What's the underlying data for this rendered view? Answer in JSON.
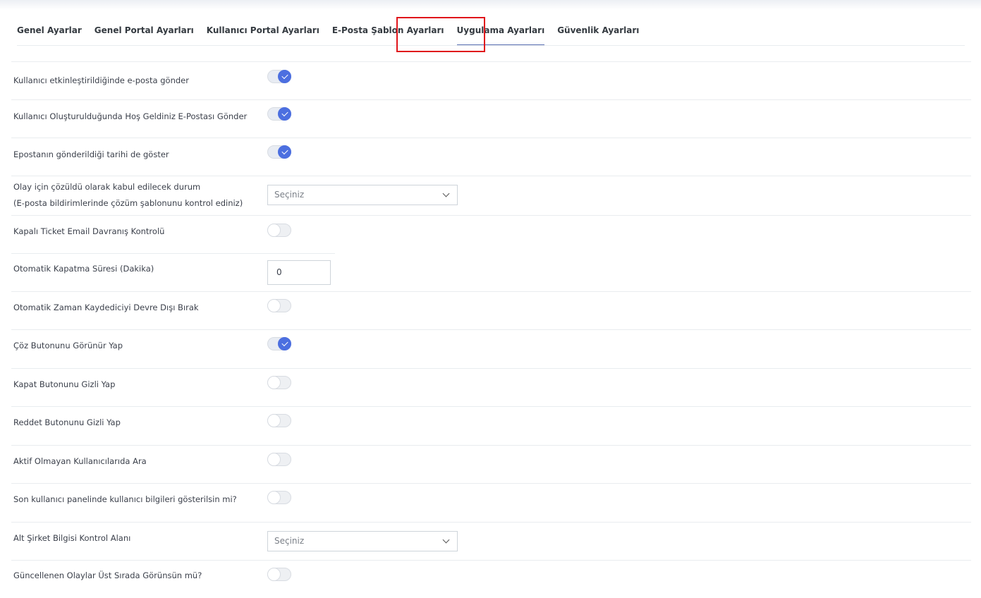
{
  "tabs": [
    {
      "label": "Genel Ayarlar"
    },
    {
      "label": "Genel Portal Ayarları"
    },
    {
      "label": "Kullanıcı Portal Ayarları"
    },
    {
      "label": "E-Posta Şablon Ayarları"
    },
    {
      "label": "Uygulama Ayarları",
      "active": true
    },
    {
      "label": "Güvenlik Ayarları"
    }
  ],
  "settings": [
    {
      "label": "Kullanıcı etkinleştirildiğinde e-posta gönder",
      "type": "toggle",
      "on": true
    },
    {
      "label": "Kullanıcı Oluşturulduğunda Hoş Geldiniz E-Postası Gönder",
      "type": "toggle",
      "on": true
    },
    {
      "label": "Epostanın gönderildiği tarihi de göster",
      "type": "toggle",
      "on": true
    },
    {
      "label": "Olay için çözüldü olarak kabul edilecek durum",
      "label2": "(E-posta bildirimlerinde çözüm şablonunu kontrol ediniz)",
      "type": "select",
      "value": "Seçiniz"
    },
    {
      "label": "Kapalı Ticket Email Davranış Kontrolü",
      "type": "toggle",
      "on": false
    },
    {
      "label": "Otomatik Kapatma Süresi (Dakika)",
      "type": "number",
      "value": "0"
    },
    {
      "label": "Otomatik Zaman Kaydediciyi Devre Dışı Bırak",
      "type": "toggle",
      "on": false
    },
    {
      "label": "Çöz Butonunu Görünür Yap",
      "type": "toggle",
      "on": true
    },
    {
      "label": "Kapat Butonunu Gizli Yap",
      "type": "toggle",
      "on": false
    },
    {
      "label": "Reddet Butonunu Gizli Yap",
      "type": "toggle",
      "on": false
    },
    {
      "label": "Aktif Olmayan Kullanıcılarıda Ara",
      "type": "toggle",
      "on": false
    },
    {
      "label": "Son kullanıcı panelinde kullanıcı bilgileri gösterilsin mi?",
      "type": "toggle",
      "on": false
    },
    {
      "label": "Alt Şirket Bilgisi Kontrol Alanı",
      "type": "select",
      "value": "Seçiniz"
    },
    {
      "label": "Güncellenen Olaylar Üst Sırada Görünsün mü?",
      "type": "toggle",
      "on": false
    }
  ],
  "colors": {
    "accent": "#4c6fe0",
    "highlight": "#e0151b",
    "tab_underline": "#5a6fb3"
  }
}
